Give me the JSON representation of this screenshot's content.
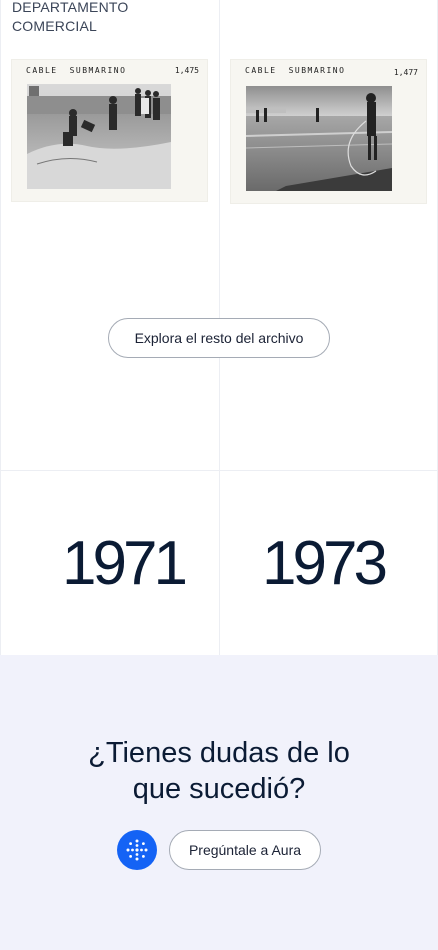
{
  "department": {
    "line1": "DEPARTAMENTO",
    "line2": "COMERCIAL"
  },
  "archive_cards": [
    {
      "caption_word1": "CABLE",
      "caption_word2": "SUBMARINO",
      "number": "1,475"
    },
    {
      "caption_word1": "CABLE",
      "caption_word2": "SUBMARINO",
      "number": "1,477"
    }
  ],
  "explore_button": {
    "label": "Explora el resto del archivo"
  },
  "years": [
    "1971",
    "1973"
  ],
  "footer": {
    "question_line1": "¿Tienes dudas de lo",
    "question_line2": "que sucedió?",
    "ask_button": "Pregúntale a Aura",
    "accent_color": "#1463f5"
  }
}
